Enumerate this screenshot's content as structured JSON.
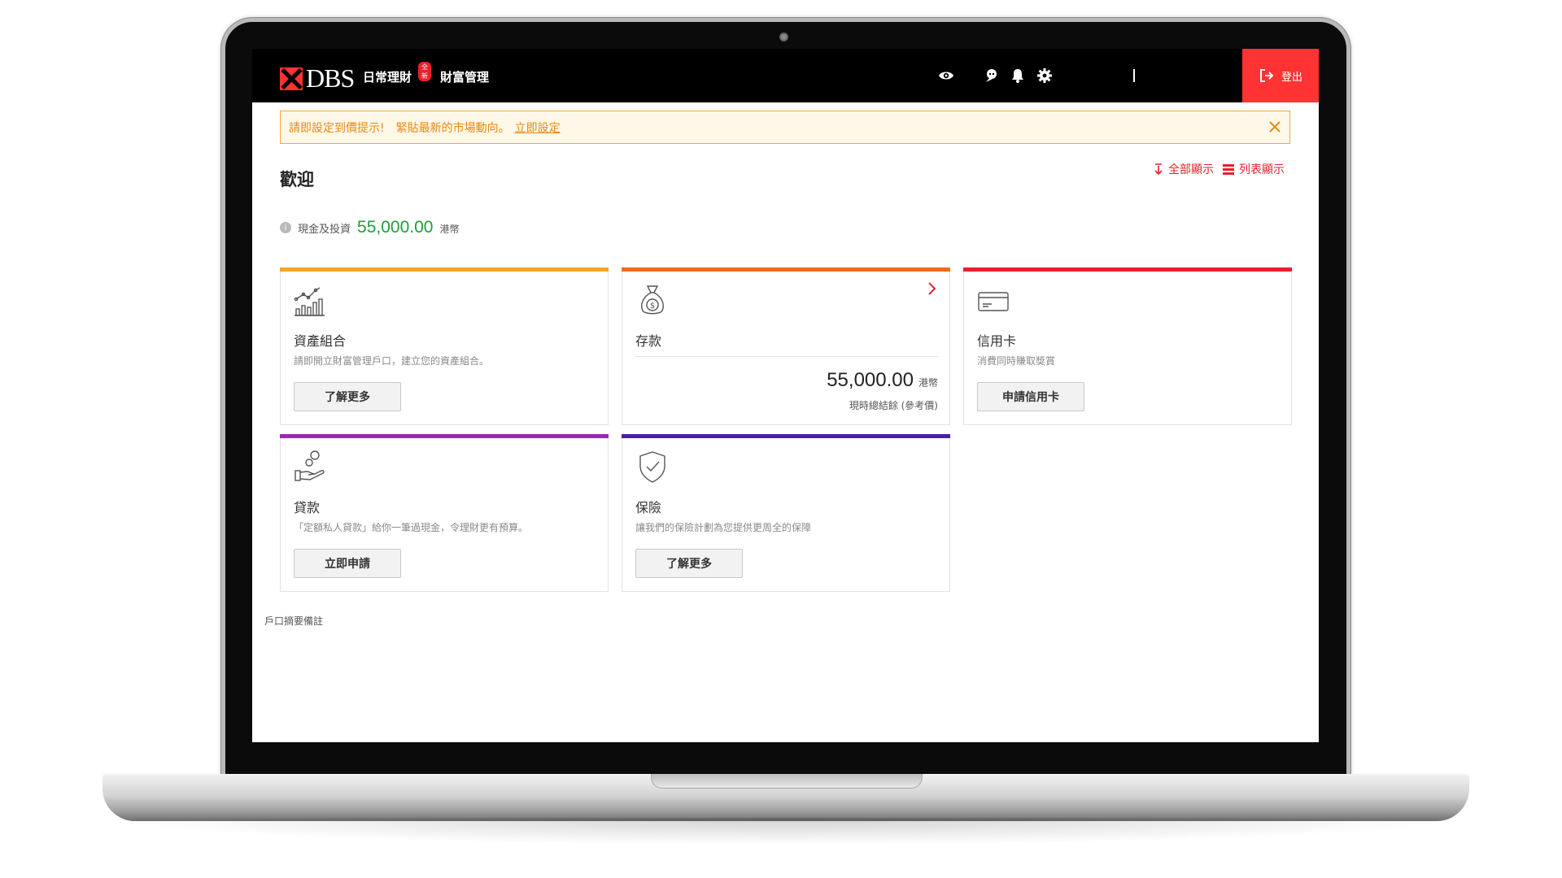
{
  "header": {
    "logo_text": "DBS",
    "nav": [
      {
        "label": "日常理財",
        "badge": "全新"
      },
      {
        "label": "財富管理"
      }
    ],
    "icons": [
      "eye-icon",
      "support-chat-icon",
      "bell-icon",
      "gear-icon"
    ],
    "logout_label": "登出"
  },
  "alert": {
    "strong": "請即設定到價提示!",
    "text": "緊貼最新的市場動向。",
    "link": "立即設定"
  },
  "welcome": "歡迎",
  "view_links": {
    "expand_all": "全部顯示",
    "list_view": "列表顯示"
  },
  "balance": {
    "label": "現金及投資",
    "amount": "55,000.00",
    "unit": "港幣"
  },
  "cards": {
    "portfolio": {
      "title": "資產組合",
      "desc": "請即開立財富管理戶口，建立您的資產組合。",
      "button": "了解更多",
      "accent": "#f5a623"
    },
    "deposits": {
      "title": "存款",
      "amount": "55,000.00",
      "unit": "港幣",
      "note": "現時總結餘 (參考價)",
      "accent": "#f26b1d"
    },
    "credit_card": {
      "title": "信用卡",
      "desc": "消費同時賺取獎賞",
      "button": "申請信用卡",
      "accent": "#e8202a"
    },
    "loans": {
      "title": "貸款",
      "desc": "「定額私人貸款」給你一筆過現金，令理財更有預算。",
      "button": "立即申請",
      "accent": "#9c27b0"
    },
    "insurance": {
      "title": "保險",
      "desc": "讓我們的保險計劃為您提供更周全的保障",
      "button": "了解更多",
      "accent": "#4a1fa8"
    }
  },
  "footnote": "戶口摘要備註"
}
